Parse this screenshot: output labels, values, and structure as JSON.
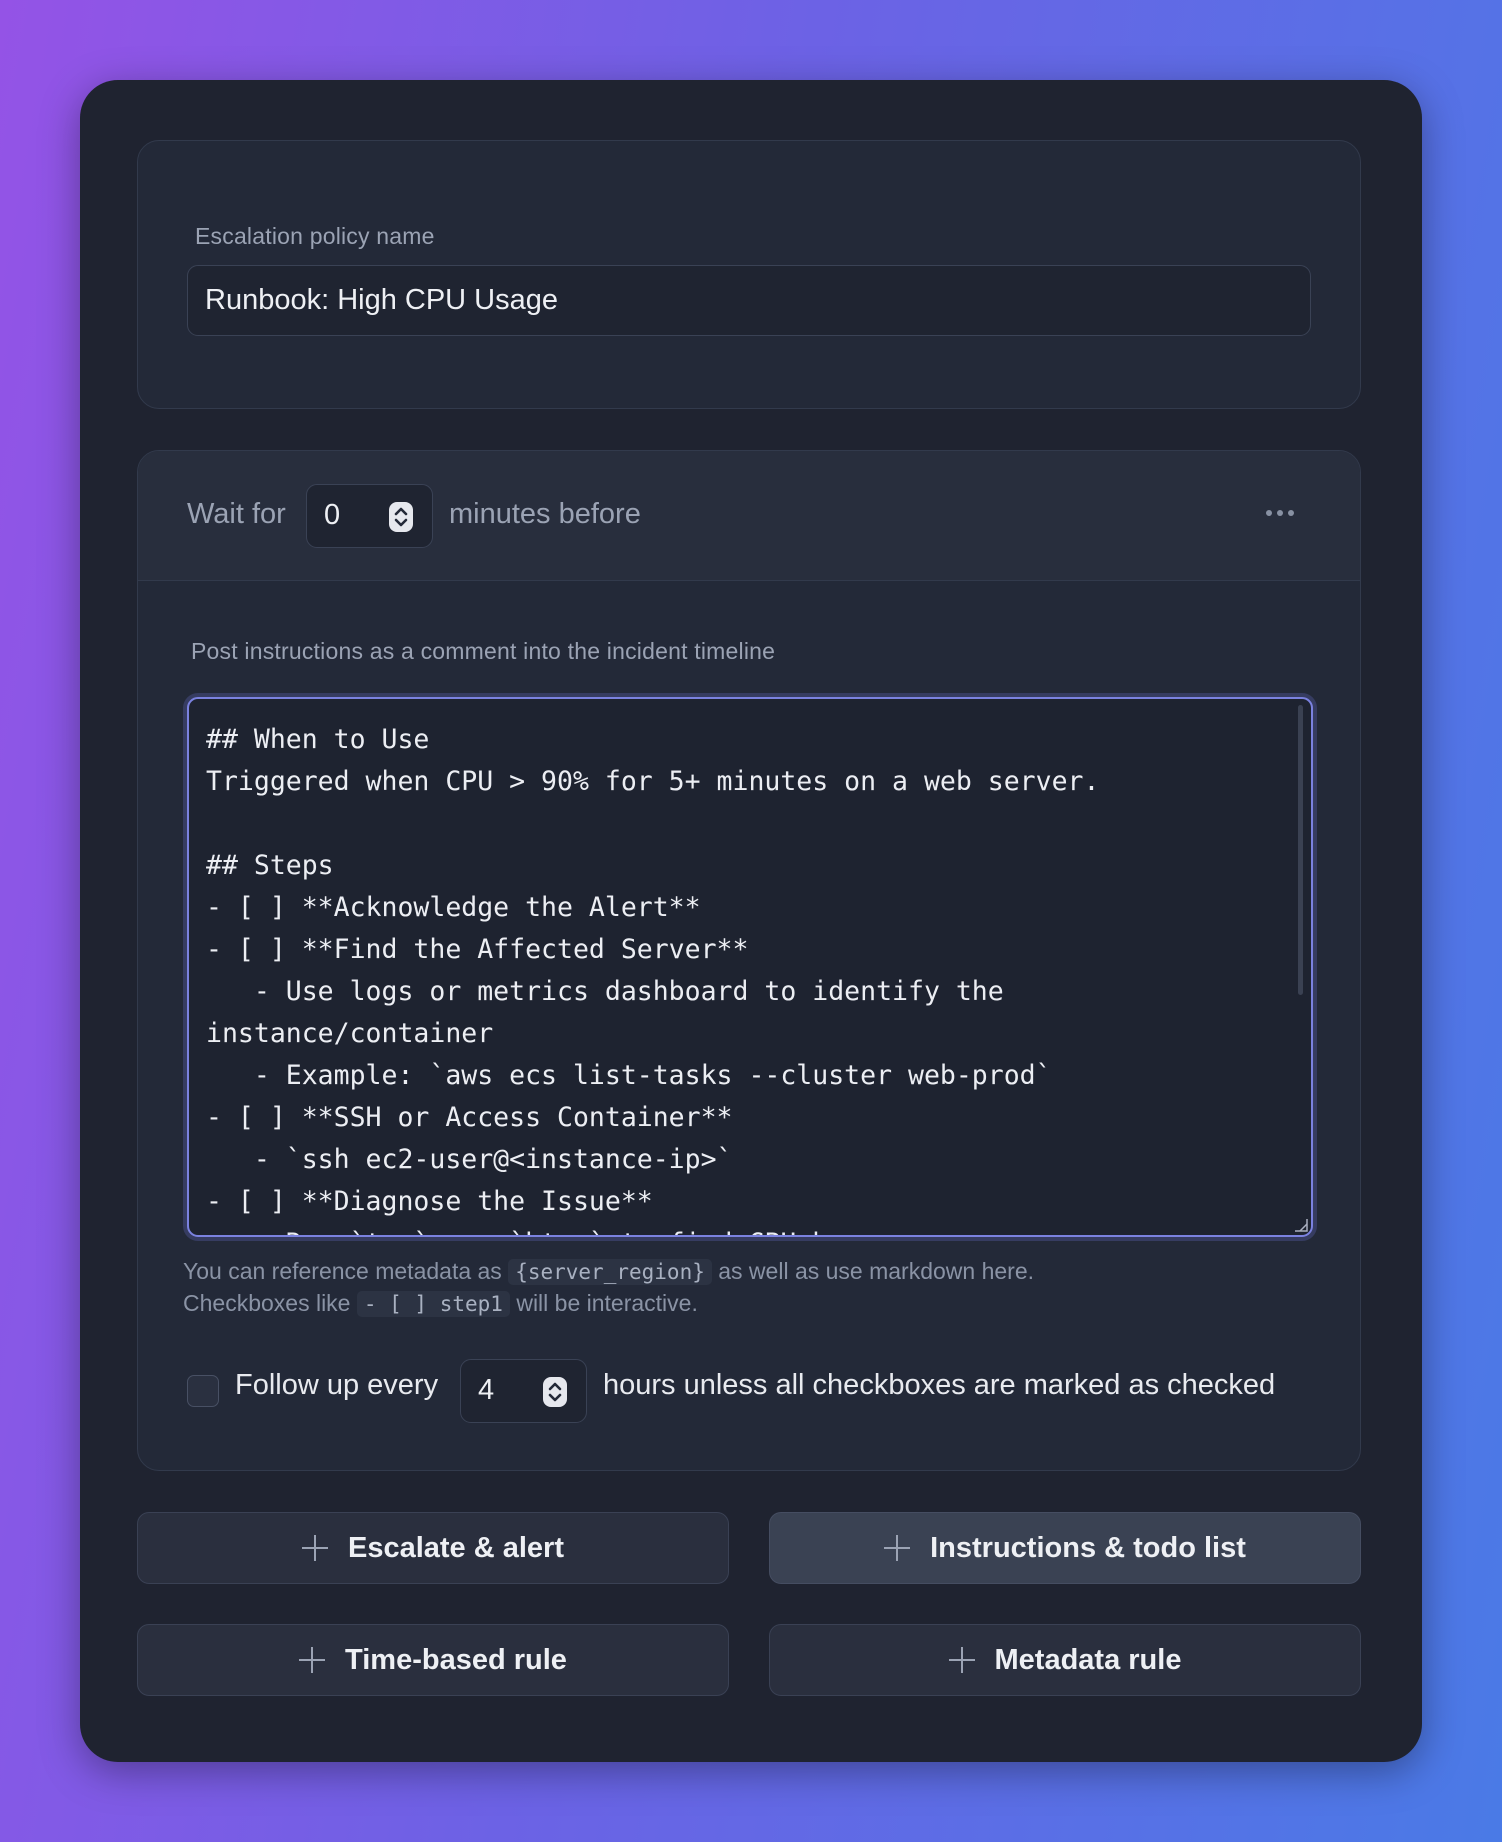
{
  "policy": {
    "label": "Escalation policy name",
    "value": "Runbook: High CPU Usage"
  },
  "step": {
    "wait_prefix": "Wait for",
    "wait_minutes": "0",
    "wait_suffix": "minutes before",
    "more_icon": "ellipsis-icon",
    "instructions_label": "Post instructions as a comment into the incident timeline",
    "instructions_text": "## When to Use\nTriggered when CPU > 90% for 5+ minutes on a web server.\n\n## Steps\n- [ ] **Acknowledge the Alert**\n- [ ] **Find the Affected Server**\n   - Use logs or metrics dashboard to identify the\ninstance/container\n   - Example: `aws ecs list-tasks --cluster web-prod`\n- [ ] **SSH or Access Container**\n   - `ssh ec2-user@<instance-ip>`\n- [ ] **Diagnose the Issue**\n   - Run `top`, or `htop` to find CPU hogs",
    "helper_1a": "You can reference metadata as",
    "helper_code_1": "{server_region}",
    "helper_1b": "as well as use markdown here.",
    "helper_2a": "Checkboxes like",
    "helper_code_2": "- [ ] step1",
    "helper_2b": "will be interactive.",
    "follow_checked": false,
    "follow_prefix": "Follow up every",
    "follow_hours": "4",
    "follow_suffix": "hours unless all checkboxes are marked as checked"
  },
  "actions": {
    "escalate": "Escalate & alert",
    "instructions": "Instructions & todo list",
    "time_rule": "Time-based rule",
    "metadata_rule": "Metadata rule"
  },
  "colors": {
    "accent": "#7b82e0",
    "panel": "#232938",
    "window": "#1f2330"
  }
}
